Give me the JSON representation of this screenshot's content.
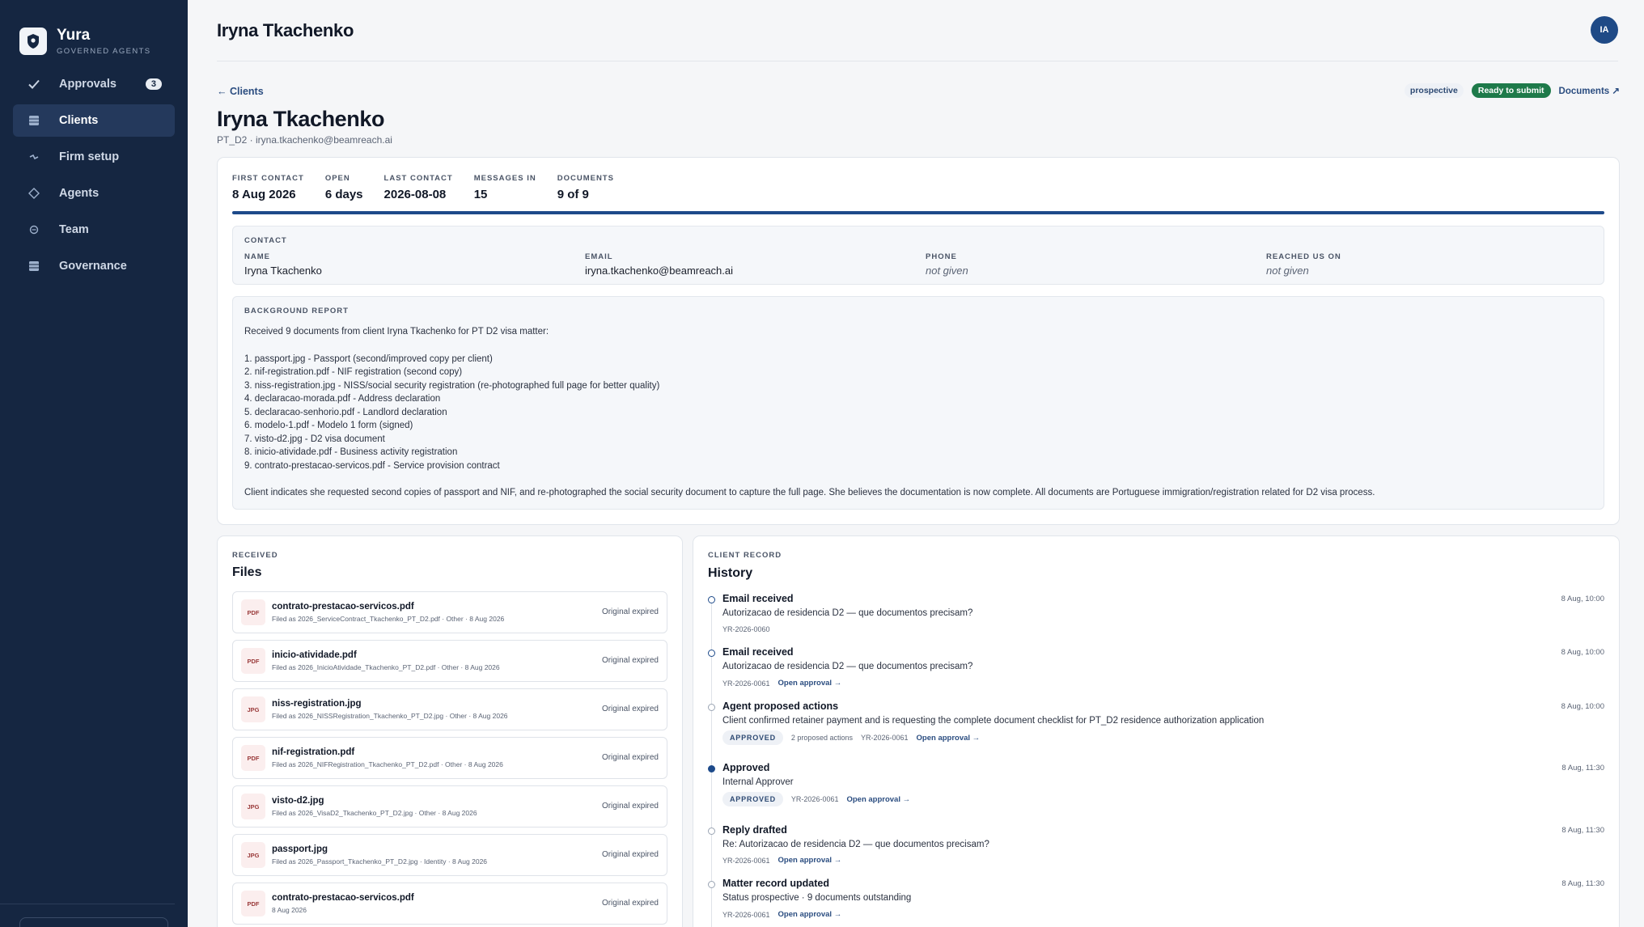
{
  "app": {
    "name": "Yura",
    "tagline": "GOVERNED AGENTS"
  },
  "sidebar": {
    "items": [
      {
        "label": "Approvals",
        "icon": "check-icon",
        "badge": "3",
        "active": false
      },
      {
        "label": "Clients",
        "icon": "grid-icon",
        "active": true
      },
      {
        "label": "Firm setup",
        "icon": "sliders-icon",
        "active": false
      },
      {
        "label": "Agents",
        "icon": "diamond-icon",
        "active": false
      },
      {
        "label": "Team",
        "icon": "team-icon",
        "active": false
      },
      {
        "label": "Governance",
        "icon": "grid-icon",
        "active": false
      }
    ]
  },
  "topbar": {
    "title": "Iryna Tkachenko",
    "avatar_initials": "IA"
  },
  "client": {
    "back_link": "← Clients",
    "name": "Iryna Tkachenko",
    "subtitle": "PT_D2 · iryna.tkachenko@beamreach.ai",
    "status_tag": "prospective",
    "ready_tag": "Ready to submit",
    "documents_link": "Documents ↗"
  },
  "stats": [
    {
      "label": "FIRST CONTACT",
      "value": "8 Aug 2026"
    },
    {
      "label": "OPEN",
      "value": "6 days"
    },
    {
      "label": "LAST CONTACT",
      "value": "2026-08-08"
    },
    {
      "label": "MESSAGES IN",
      "value": "15"
    },
    {
      "label": "DOCUMENTS",
      "value": "9 of 9"
    }
  ],
  "documents_progress": 1.0,
  "contact": {
    "heading": "CONTACT",
    "name_label": "NAME",
    "name": "Iryna Tkachenko",
    "email_label": "EMAIL",
    "email": "iryna.tkachenko@beamreach.ai",
    "phone_label": "PHONE",
    "phone": "not given",
    "reached_label": "REACHED US ON",
    "reached": "not given"
  },
  "background": {
    "heading": "BACKGROUND REPORT",
    "intro": "Received 9 documents from client Iryna Tkachenko for PT D2 visa matter:",
    "items": [
      "1. passport.jpg - Passport (second/improved copy per client)",
      "2. nif-registration.pdf - NIF registration (second copy)",
      "3. niss-registration.jpg - NISS/social security registration (re-photographed full page for better quality)",
      "4. declaracao-morada.pdf - Address declaration",
      "5. declaracao-senhorio.pdf - Landlord declaration",
      "6. modelo-1.pdf - Modelo 1 form (signed)",
      "7. visto-d2.jpg - D2 visa document",
      "8. inicio-atividade.pdf - Business activity registration",
      "9. contrato-prestacao-servicos.pdf - Service provision contract"
    ],
    "closing": "Client indicates she requested second copies of passport and NIF, and re-photographed the social security document to capture the full page. She believes the documentation is now complete. All documents are Portuguese immigration/registration related for D2 visa process."
  },
  "files": {
    "kicker": "RECEIVED",
    "title": "Files",
    "items": [
      {
        "type": "PDF",
        "name": "contrato-prestacao-servicos.pdf",
        "meta": "Filed as 2026_ServiceContract_Tkachenko_PT_D2.pdf · Other · 8 Aug 2026",
        "status": "Original expired"
      },
      {
        "type": "PDF",
        "name": "inicio-atividade.pdf",
        "meta": "Filed as 2026_InicioAtividade_Tkachenko_PT_D2.pdf · Other · 8 Aug 2026",
        "status": "Original expired"
      },
      {
        "type": "JPG",
        "name": "niss-registration.jpg",
        "meta": "Filed as 2026_NISSRegistration_Tkachenko_PT_D2.jpg · Other · 8 Aug 2026",
        "status": "Original expired"
      },
      {
        "type": "PDF",
        "name": "nif-registration.pdf",
        "meta": "Filed as 2026_NIFRegistration_Tkachenko_PT_D2.pdf · Other · 8 Aug 2026",
        "status": "Original expired"
      },
      {
        "type": "JPG",
        "name": "visto-d2.jpg",
        "meta": "Filed as 2026_VisaD2_Tkachenko_PT_D2.jpg · Other · 8 Aug 2026",
        "status": "Original expired"
      },
      {
        "type": "JPG",
        "name": "passport.jpg",
        "meta": "Filed as 2026_Passport_Tkachenko_PT_D2.jpg · Identity · 8 Aug 2026",
        "status": "Original expired"
      },
      {
        "type": "PDF",
        "name": "contrato-prestacao-servicos.pdf",
        "meta": "8 Aug 2026",
        "status": "Original expired"
      }
    ]
  },
  "history": {
    "kicker": "CLIENT RECORD",
    "title": "History",
    "events": [
      {
        "title": "Email received",
        "time": "8 Aug, 10:00",
        "desc": "Autorizacao de residencia D2 — que documentos precisam?",
        "ref": "YR-2026-0060",
        "link": "",
        "badge": "",
        "actions": "",
        "dot": "blue"
      },
      {
        "title": "Email received",
        "time": "8 Aug, 10:00",
        "desc": "Autorizacao de residencia D2 — que documentos precisam?",
        "ref": "YR-2026-0061",
        "link": "Open approval →",
        "badge": "",
        "actions": "",
        "dot": "blue"
      },
      {
        "title": "Agent proposed actions",
        "time": "8 Aug, 10:00",
        "desc": "Client confirmed retainer payment and is requesting the complete document checklist for PT_D2 residence authorization application",
        "ref": "YR-2026-0061",
        "link": "Open approval →",
        "badge": "APPROVED",
        "actions": "2 proposed actions",
        "dot": "grey"
      },
      {
        "title": "Approved",
        "time": "8 Aug, 11:30",
        "desc": "Internal Approver",
        "ref": "YR-2026-0061",
        "link": "Open approval →",
        "badge": "APPROVED",
        "actions": "",
        "dot": "filled"
      },
      {
        "title": "Reply drafted",
        "time": "8 Aug, 11:30",
        "desc": "Re: Autorizacao de residencia D2 — que documentos precisam?",
        "ref": "YR-2026-0061",
        "link": "Open approval →",
        "badge": "",
        "actions": "",
        "dot": "grey"
      },
      {
        "title": "Matter record updated",
        "time": "8 Aug, 11:30",
        "desc": "Status prospective · 9 documents outstanding",
        "ref": "YR-2026-0061",
        "link": "Open approval →",
        "badge": "",
        "actions": "",
        "dot": "grey"
      }
    ]
  }
}
